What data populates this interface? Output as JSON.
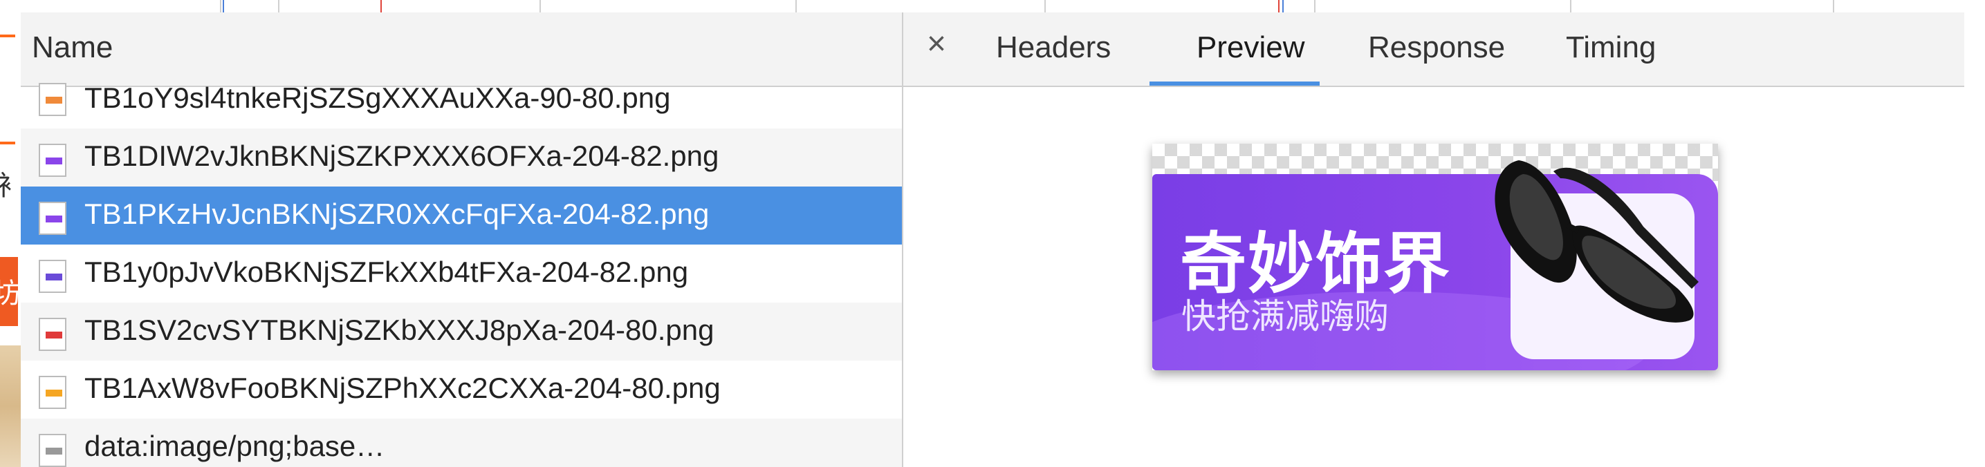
{
  "left_page": {
    "chars": [
      "衤",
      "坊"
    ]
  },
  "network": {
    "column_header": "Name",
    "requests": [
      {
        "name": "TB1oY9sl4tnkeRjSZSgXXXAuXXa-90-80.png",
        "icon_color": "#f08a3a"
      },
      {
        "name": "TB1DIW2vJknBKNjSZKPXXX6OFXa-204-82.png",
        "icon_color": "#8a45ea"
      },
      {
        "name": "TB1PKzHvJcnBKNjSZR0XXcFqFXa-204-82.png",
        "icon_color": "#8a45ea",
        "selected": true
      },
      {
        "name": "TB1y0pJvVkoBKNjSZFkXXb4tFXa-204-82.png",
        "icon_color": "#6a4bd8"
      },
      {
        "name": "TB1SV2cvSYTBKNjSZKbXXXJ8pXa-204-80.png",
        "icon_color": "#e03a3a"
      },
      {
        "name": "TB1AxW8vFooBKNjSZPhXXc2CXXa-204-80.png",
        "icon_color": "#f5a623"
      },
      {
        "name": "data:image/png;base…",
        "icon_color": "#999999"
      }
    ]
  },
  "details": {
    "close_label": "×",
    "tabs": [
      "Headers",
      "Preview",
      "Response",
      "Timing"
    ],
    "active_tab": "Preview"
  },
  "preview": {
    "title": "奇妙饰界",
    "subtitle": "快抢满减嗨购",
    "product_icon": "sunglasses-icon"
  },
  "colors": {
    "selected_row": "#4a90e2",
    "active_tab_underline": "#4a90e2",
    "banner": "#8a45ea"
  }
}
